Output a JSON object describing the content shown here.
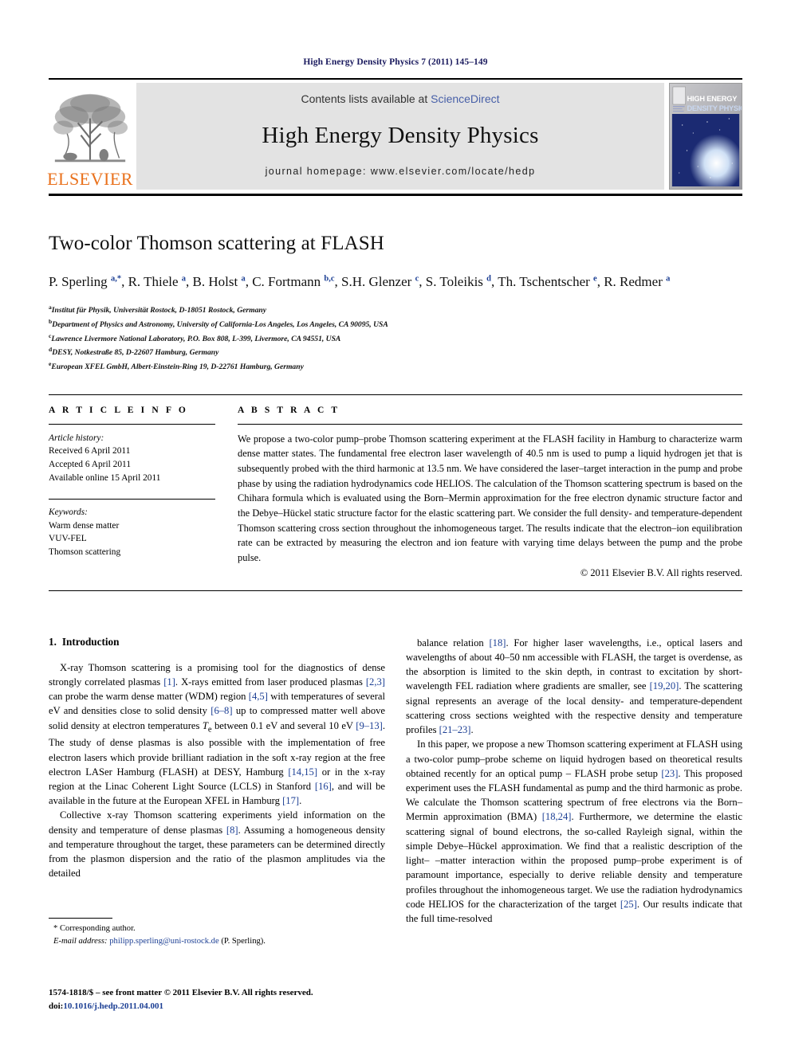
{
  "running_head": "High Energy Density Physics 7 (2011) 145–149",
  "masthead": {
    "publisher_name": "ELSEVIER",
    "contents_prefix": "Contents lists available at ",
    "sciencedirect_link": "ScienceDirect",
    "journal_title": "High Energy Density Physics",
    "homepage_label": "journal homepage: www.elsevier.com/locate/hedp",
    "cover_line1": "HIGH ENERGY",
    "cover_line2": "DENSITY PHYSICS",
    "sd_link_color": "#4860a8",
    "elsevier_orange": "#E9711C"
  },
  "article": {
    "title": "Two-color Thomson scattering at FLASH",
    "authors_html": "P. Sperling <sup>a,*</sup>, R. Thiele <sup>a</sup>, B. Holst <sup>a</sup>, C. Fortmann <sup>b,c</sup>, S.H. Glenzer <sup>c</sup>, S. Toleikis <sup>d</sup>, Th. Tschentscher <sup>e</sup>, R. Redmer <sup>a</sup>",
    "affiliations": [
      {
        "mark": "a",
        "text": "Institut für Physik, Universität Rostock, D-18051 Rostock, Germany"
      },
      {
        "mark": "b",
        "text": "Department of Physics and Astronomy, University of California-Los Angeles, Los Angeles, CA 90095, USA"
      },
      {
        "mark": "c",
        "text": "Lawrence Livermore National Laboratory, P.O. Box 808, L-399, Livermore, CA 94551, USA"
      },
      {
        "mark": "d",
        "text": "DESY, Notkestraße 85, D-22607 Hamburg, Germany"
      },
      {
        "mark": "e",
        "text": "European XFEL GmbH, Albert-Einstein-Ring 19, D-22761 Hamburg, Germany"
      }
    ]
  },
  "article_info": {
    "heading": "A R T I C L E   I N F O",
    "history_label": "Article history:",
    "history": [
      "Received 6 April 2011",
      "Accepted 6 April 2011",
      "Available online 15 April 2011"
    ],
    "keywords_label": "Keywords:",
    "keywords": [
      "Warm dense matter",
      "VUV-FEL",
      "Thomson scattering"
    ]
  },
  "abstract": {
    "heading": "A B S T R A C T",
    "text": "We propose a two-color pump–probe Thomson scattering experiment at the FLASH facility in Hamburg to characterize warm dense matter states. The fundamental free electron laser wavelength of 40.5 nm is used to pump a liquid hydrogen jet that is subsequently probed with the third harmonic at 13.5 nm. We have considered the laser–target interaction in the pump and probe phase by using the radiation hydrodynamics code HELIOS. The calculation of the Thomson scattering spectrum is based on the Chihara formula which is evaluated using the Born–Mermin approximation for the free electron dynamic structure factor and the Debye–Hückel static structure factor for the elastic scattering part. We consider the full density- and temperature-dependent Thomson scattering cross section throughout the inhomogeneous target. The results indicate that the electron–ion equilibration rate can be extracted by measuring the electron and ion feature with varying time delays between the pump and the probe pulse.",
    "copyright": "© 2011 Elsevier B.V. All rights reserved."
  },
  "body": {
    "section_number": "1.",
    "section_title": "Introduction",
    "left_paragraphs_html": [
      "X-ray Thomson scattering is a promising tool for the diagnostics of dense strongly correlated plasmas <span class=\"ref\">[1]</span>. X-rays emitted from laser produced plasmas <span class=\"ref\">[2,3]</span> can probe the warm dense matter (WDM) region <span class=\"ref\">[4,5]</span> with temperatures of several eV and densities close to solid density <span class=\"ref\">[6–8]</span> up to compressed matter well above solid density at electron temperatures <i>T</i><sub>e</sub> between 0.1 eV and several 10 eV <span class=\"ref\">[9–13]</span>. The study of dense plasmas is also possible with the implementation of free electron lasers which provide brilliant radiation in the soft x-ray region at the free electron LASer Hamburg (FLASH) at DESY, Hamburg <span class=\"ref\">[14,15]</span> or in the x-ray region at the Linac Coherent Light Source (LCLS) in Stanford <span class=\"ref\">[16]</span>, and will be available in the future at the European XFEL in Hamburg <span class=\"ref\">[17]</span>.",
      "Collective x-ray Thomson scattering experiments yield information on the density and temperature of dense plasmas <span class=\"ref\">[8]</span>. Assuming a homogeneous density and temperature throughout the target, these parameters can be determined directly from the plasmon dispersion and the ratio of the plasmon amplitudes via the detailed"
    ],
    "right_paragraphs_html": [
      "balance relation <span class=\"ref\">[18]</span>. For higher laser wavelengths, i.e., optical lasers and wavelengths of about 40–50 nm accessible with FLASH, the target is overdense, as the absorption is limited to the skin depth, in contrast to excitation by short-wavelength FEL radiation where gradients are smaller, see <span class=\"ref\">[19,20]</span>. The scattering signal represents an average of the local density- and temperature-dependent scattering cross sections weighted with the respective density and temperature profiles <span class=\"ref\">[21–23]</span>.",
      "In this paper, we propose a new Thomson scattering experiment at FLASH using a two-color pump–probe scheme on liquid hydrogen based on theoretical results obtained recently for an optical pump – FLASH probe setup <span class=\"ref\">[23]</span>. This proposed experiment uses the FLASH fundamental as pump and the third harmonic as probe. We calculate the Thomson scattering spectrum of free electrons via the Born–Mermin approximation (BMA) <span class=\"ref\">[18,24]</span>. Furthermore, we determine the elastic scattering signal of bound electrons, the so-called Rayleigh signal, within the simple Debye–Hückel approximation. We find that a realistic description of the light– –matter interaction within the proposed pump–probe experiment is of paramount importance, especially to derive reliable density and temperature profiles throughout the inhomogeneous target. We use the radiation hydrodynamics code HELIOS for the characterization of the target <span class=\"ref\">[25]</span>. Our results indicate that the full time-resolved"
    ]
  },
  "footnote": {
    "corresponding_marker": "*",
    "corresponding_text": "Corresponding author.",
    "email_label": "E-mail address:",
    "email": "philipp.sperling@uni-rostock.de",
    "email_owner": "(P. Sperling)."
  },
  "frontmatter": {
    "line1": "1574-1818/$ – see front matter © 2011 Elsevier B.V. All rights reserved.",
    "doi_label": "doi:",
    "doi_value": "10.1016/j.hedp.2011.04.001"
  }
}
